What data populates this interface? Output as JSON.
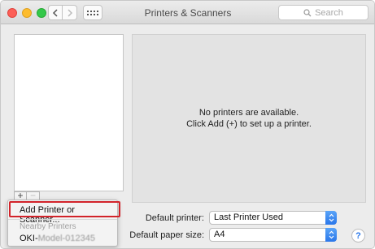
{
  "window": {
    "title": "Printers & Scanners",
    "search_placeholder": "Search"
  },
  "printer_list": {
    "add_label": "+",
    "remove_label": "−"
  },
  "detail": {
    "empty_line1": "No printers are available.",
    "empty_line2": "Click Add (+) to set up a printer."
  },
  "add_menu": {
    "add_item": "Add Printer or Scanner...",
    "section_header": "Nearby Printers",
    "printer_prefix": "OKI-",
    "printer_suffix": "Model-012345"
  },
  "defaults": {
    "printer_label": "Default printer:",
    "printer_value": "Last Printer Used",
    "paper_label": "Default paper size:",
    "paper_value": "A4"
  },
  "help": {
    "label": "?"
  },
  "colors": {
    "highlight_border": "#d2232a",
    "select_accent": "#2a77ea"
  }
}
